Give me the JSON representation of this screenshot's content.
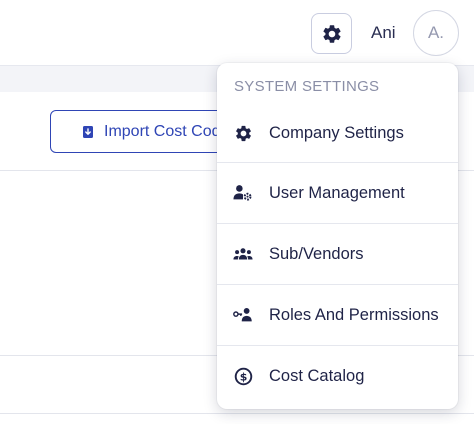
{
  "header": {
    "user_name": "Ani",
    "avatar_initials": "A."
  },
  "page": {
    "import_button_label": "Import Cost Codes"
  },
  "menu": {
    "section_title": "SYSTEM SETTINGS",
    "items": [
      {
        "label": "Company Settings",
        "icon": "gear-icon"
      },
      {
        "label": "User Management",
        "icon": "user-gear-icon"
      },
      {
        "label": "Sub/Vendors",
        "icon": "users-group-icon"
      },
      {
        "label": "Roles And Permissions",
        "icon": "user-key-icon"
      },
      {
        "label": "Cost Catalog",
        "icon": "dollar-circle-icon"
      }
    ]
  },
  "colors": {
    "primary": "#2f45b5",
    "icon": "#1f2347",
    "muted": "#8a8ea6"
  }
}
